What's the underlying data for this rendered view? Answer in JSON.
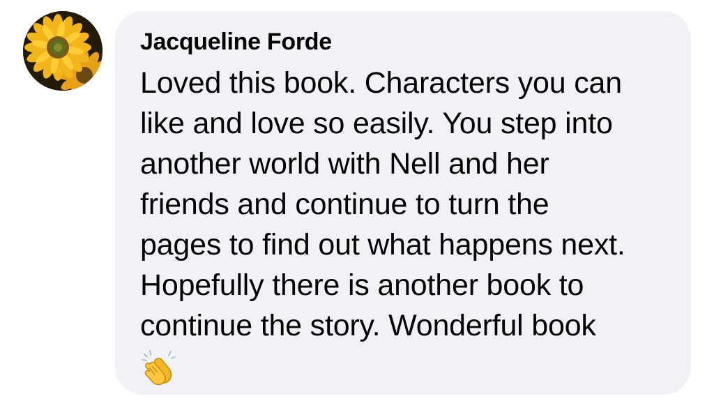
{
  "comment": {
    "author": "Jacqueline Forde",
    "text": "Loved this book. Characters you can\nlike and love so easily. You step into\nanother world with Nell and her\nfriends and continue to turn the\npages to find out what happens next.\nHopefully there is another book to\ncontinue the story. Wonderful book",
    "avatar_icon": "sunflower-avatar",
    "emoji_icon": "clapping-hands-emoji"
  },
  "colors": {
    "bubble_background": "#f0f2f5",
    "text": "#050505",
    "emoji_yellow": "#ffc83d"
  }
}
